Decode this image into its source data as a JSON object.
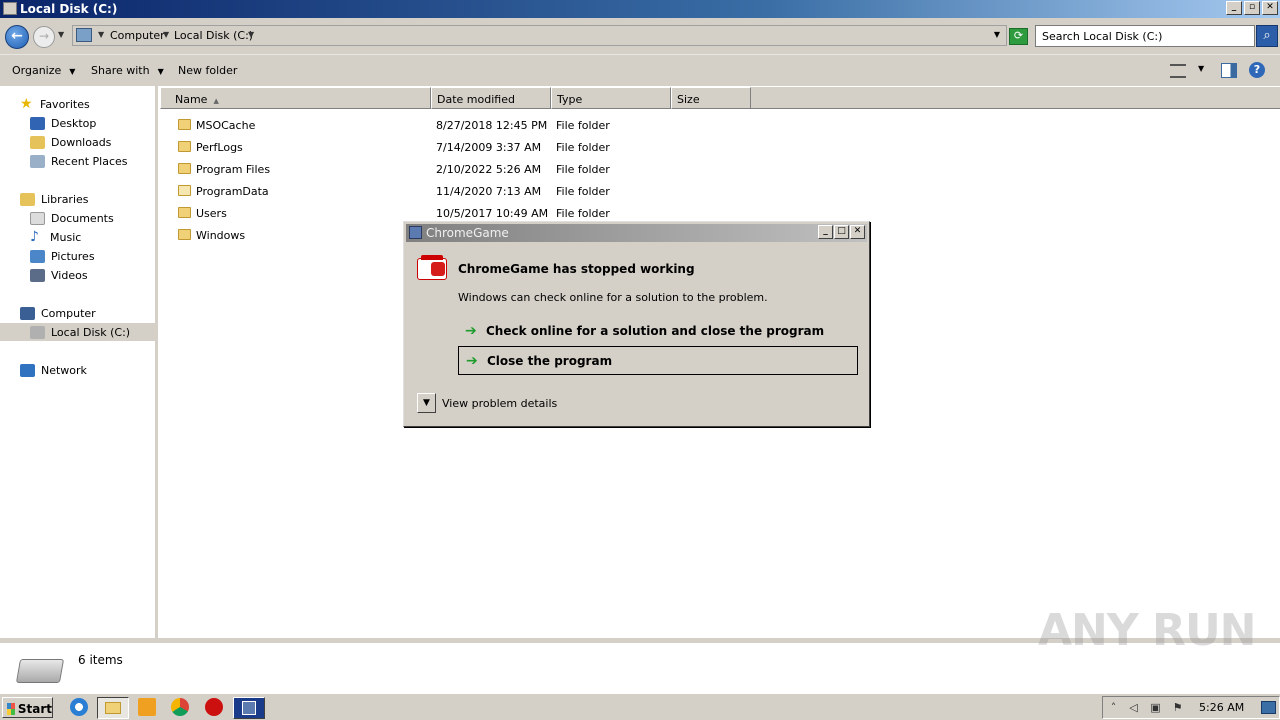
{
  "window": {
    "title": "Local Disk (C:)"
  },
  "address": {
    "crumbs": [
      "Computer",
      "Local Disk (C:)"
    ],
    "search_placeholder": "Search Local Disk (C:)"
  },
  "toolbar": {
    "organize": "Organize",
    "share_with": "Share with",
    "new_folder": "New folder"
  },
  "nav": {
    "favorites": "Favorites",
    "desktop": "Desktop",
    "downloads": "Downloads",
    "recent_places": "Recent Places",
    "libraries": "Libraries",
    "documents": "Documents",
    "music": "Music",
    "pictures": "Pictures",
    "videos": "Videos",
    "computer": "Computer",
    "local_disk": "Local Disk (C:)",
    "network": "Network"
  },
  "columns": {
    "name": "Name",
    "date": "Date modified",
    "type": "Type",
    "size": "Size"
  },
  "files": [
    {
      "name": "MSOCache",
      "date": "8/27/2018 12:45 PM",
      "type": "File folder"
    },
    {
      "name": "PerfLogs",
      "date": "7/14/2009 3:37 AM",
      "type": "File folder"
    },
    {
      "name": "Program Files",
      "date": "2/10/2022 5:26 AM",
      "type": "File folder"
    },
    {
      "name": "ProgramData",
      "date": "11/4/2020 7:13 AM",
      "type": "File folder"
    },
    {
      "name": "Users",
      "date": "10/5/2017 10:49 AM",
      "type": "File folder"
    },
    {
      "name": "Windows",
      "date": "",
      "type": ""
    }
  ],
  "status": {
    "count": "6 items"
  },
  "watermark": "ANY RUN",
  "dialog": {
    "title": "ChromeGame",
    "heading": "ChromeGame has stopped working",
    "message": "Windows can check online for a solution to the problem.",
    "option_check": "Check online for a solution and close the program",
    "option_close": "Close the program",
    "details": "View problem details"
  },
  "taskbar": {
    "start": "Start",
    "clock": "5:26 AM"
  }
}
